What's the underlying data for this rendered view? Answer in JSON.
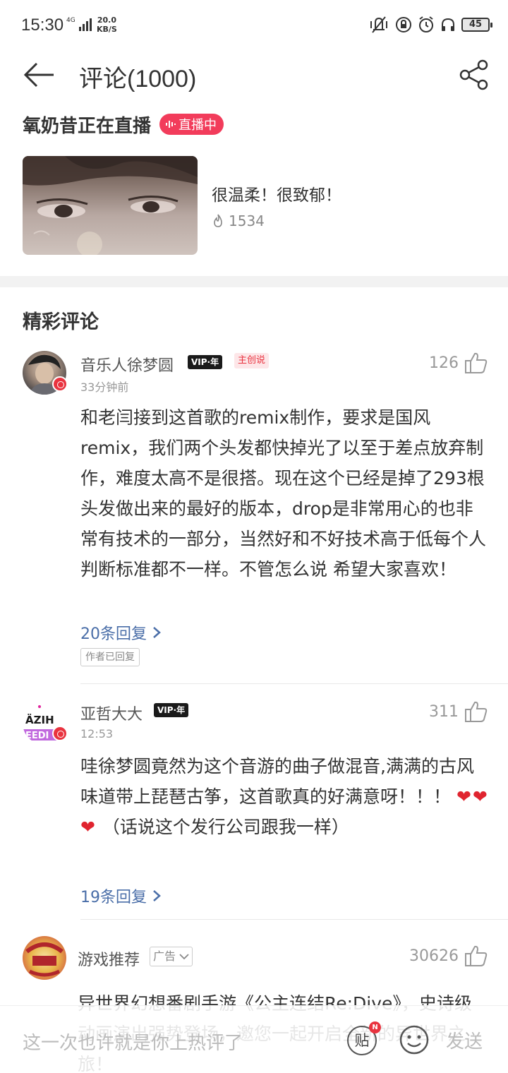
{
  "status_bar": {
    "time": "15:30",
    "network": "4G",
    "speed_value": "20.0",
    "speed_unit": "KB/S",
    "battery": "45"
  },
  "header": {
    "title": "评论(1000)"
  },
  "live": {
    "name": "氧奶昔正在直播",
    "badge": "直播中"
  },
  "song": {
    "caption": "很温柔！很致郁！",
    "heat": "1534"
  },
  "section_title": "精彩评论",
  "comments": [
    {
      "name": "音乐人徐梦圆",
      "vip": "VIP·年",
      "creator_tag": "主创说",
      "time": "33分钟前",
      "likes": "126",
      "text": "和老闫接到这首歌的remix制作，要求是国风remix，我们两个头发都快掉光了以至于差点放弃制作，难度太高不是很搭。现在这个已经是掉了293根头发做出来的最好的版本，drop是非常用心的也非常有技术的一部分，当然好和不好技术高于低每个人判断标准都不一样。不管怎么说 希望大家喜欢！",
      "replies": "20条回复",
      "author_replied": "作者已回复"
    },
    {
      "name": "亚哲大大",
      "vip": "VIP·年",
      "time": "12:53",
      "likes": "311",
      "text_before": "哇徐梦圆竟然为这个音游的曲子做混音,满满的古风味道带上琵琶古筝，这首歌真的好满意呀！！！",
      "hearts": "❤❤❤",
      "text_after": "（话说这个发行公司跟我一样）",
      "replies": "19条回复"
    },
    {
      "name": "游戏推荐",
      "ad_tag": "广告",
      "likes": "30626",
      "text": "异世界幻想番剧手游《公主连结Re:Dive》，史诗级动画演出强势登场，邀您一起开启全新的异世界之旅！"
    }
  ],
  "input_bar": {
    "placeholder": "这一次也许就是你上热评了",
    "tie_label": "贴",
    "tie_badge": "N",
    "send": "发送"
  },
  "colors": {
    "live_badge": "#f23c5b",
    "reply_link": "#4a6ea8",
    "red_badge": "#e9333f"
  }
}
